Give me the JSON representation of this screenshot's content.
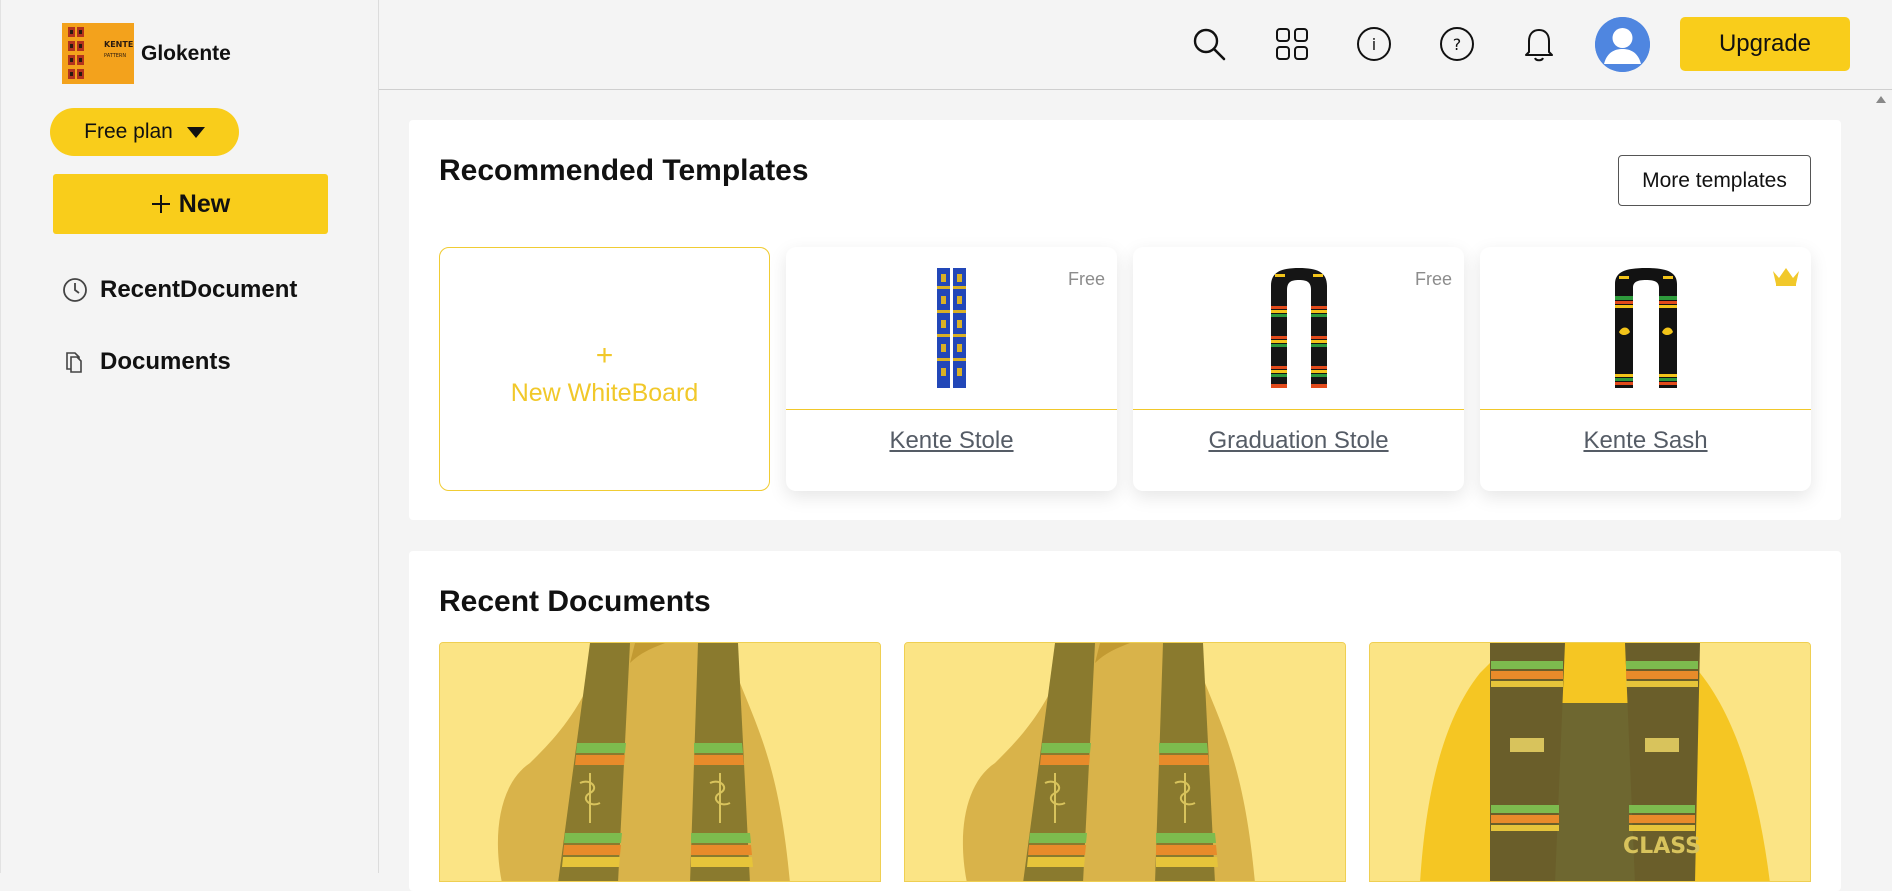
{
  "app": {
    "name": "Glokente",
    "logo_text_line1": "KENTE",
    "logo_text_line2": "PATTERN"
  },
  "sidebar": {
    "plan_label": "Free plan",
    "new_label": "New",
    "items": [
      {
        "label": "RecentDocument",
        "icon": "clock-icon"
      },
      {
        "label": "Documents",
        "icon": "documents-icon"
      }
    ]
  },
  "topbar": {
    "icons": [
      "search-icon",
      "grid-icon",
      "info-icon",
      "help-icon",
      "bell-icon"
    ],
    "upgrade_label": "Upgrade"
  },
  "templates": {
    "title": "Recommended Templates",
    "more_label": "More templates",
    "new_whiteboard_plus": "+",
    "new_whiteboard_label": "New WhiteBoard",
    "items": [
      {
        "name": "Kente Stole",
        "tag": "Free",
        "icon": "stole-thumbnail"
      },
      {
        "name": "Graduation Stole",
        "tag": "Free",
        "icon": "stole-thumbnail"
      },
      {
        "name": "Kente Sash",
        "tag": "",
        "icon": "crown-icon"
      }
    ]
  },
  "recent": {
    "title": "Recent Documents",
    "doc_text": "CLASS"
  },
  "colors": {
    "accent": "#f9cd1b",
    "accent_text": "#f1c82a",
    "avatar": "#4f86e0"
  }
}
